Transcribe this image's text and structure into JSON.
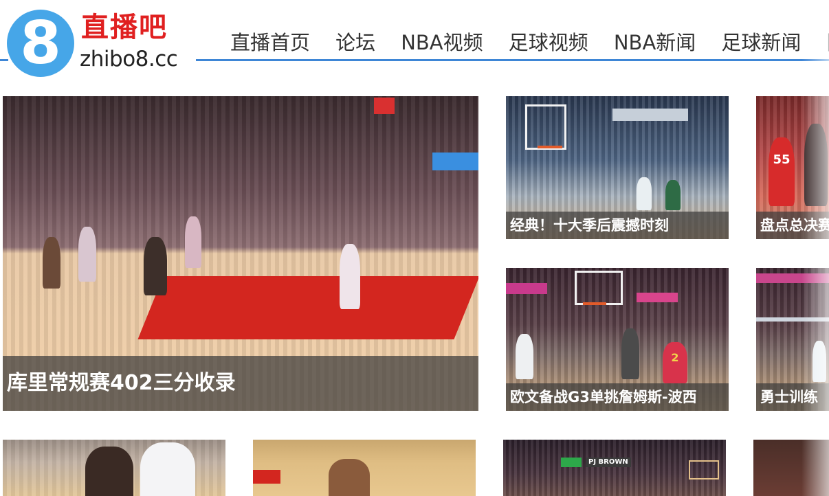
{
  "site": {
    "logo_glyph": "8",
    "logo_cn": "直播吧",
    "logo_en": "zhibo8.cc",
    "brand_color": "#46a6e8",
    "accent_color": "#e02020"
  },
  "nav": {
    "items": [
      "直播首页",
      "论坛",
      "NBA视频",
      "足球视频",
      "NBA新闻",
      "足球新闻",
      "图"
    ],
    "underline_color": "#3e86d6"
  },
  "featured": {
    "caption": "库里常规赛402三分收录",
    "icon": "video-thumbnail"
  },
  "tiles": [
    {
      "caption": "经典！十大季后震撼时刻"
    },
    {
      "caption": "盘点总决赛"
    },
    {
      "caption": "欧文备战G3单挑詹姆斯-波西"
    },
    {
      "caption": "勇士训练"
    }
  ],
  "scene_text": {
    "jersey_55": "55",
    "jersey_2": "2",
    "scoreboard": "PJ BROWN"
  }
}
